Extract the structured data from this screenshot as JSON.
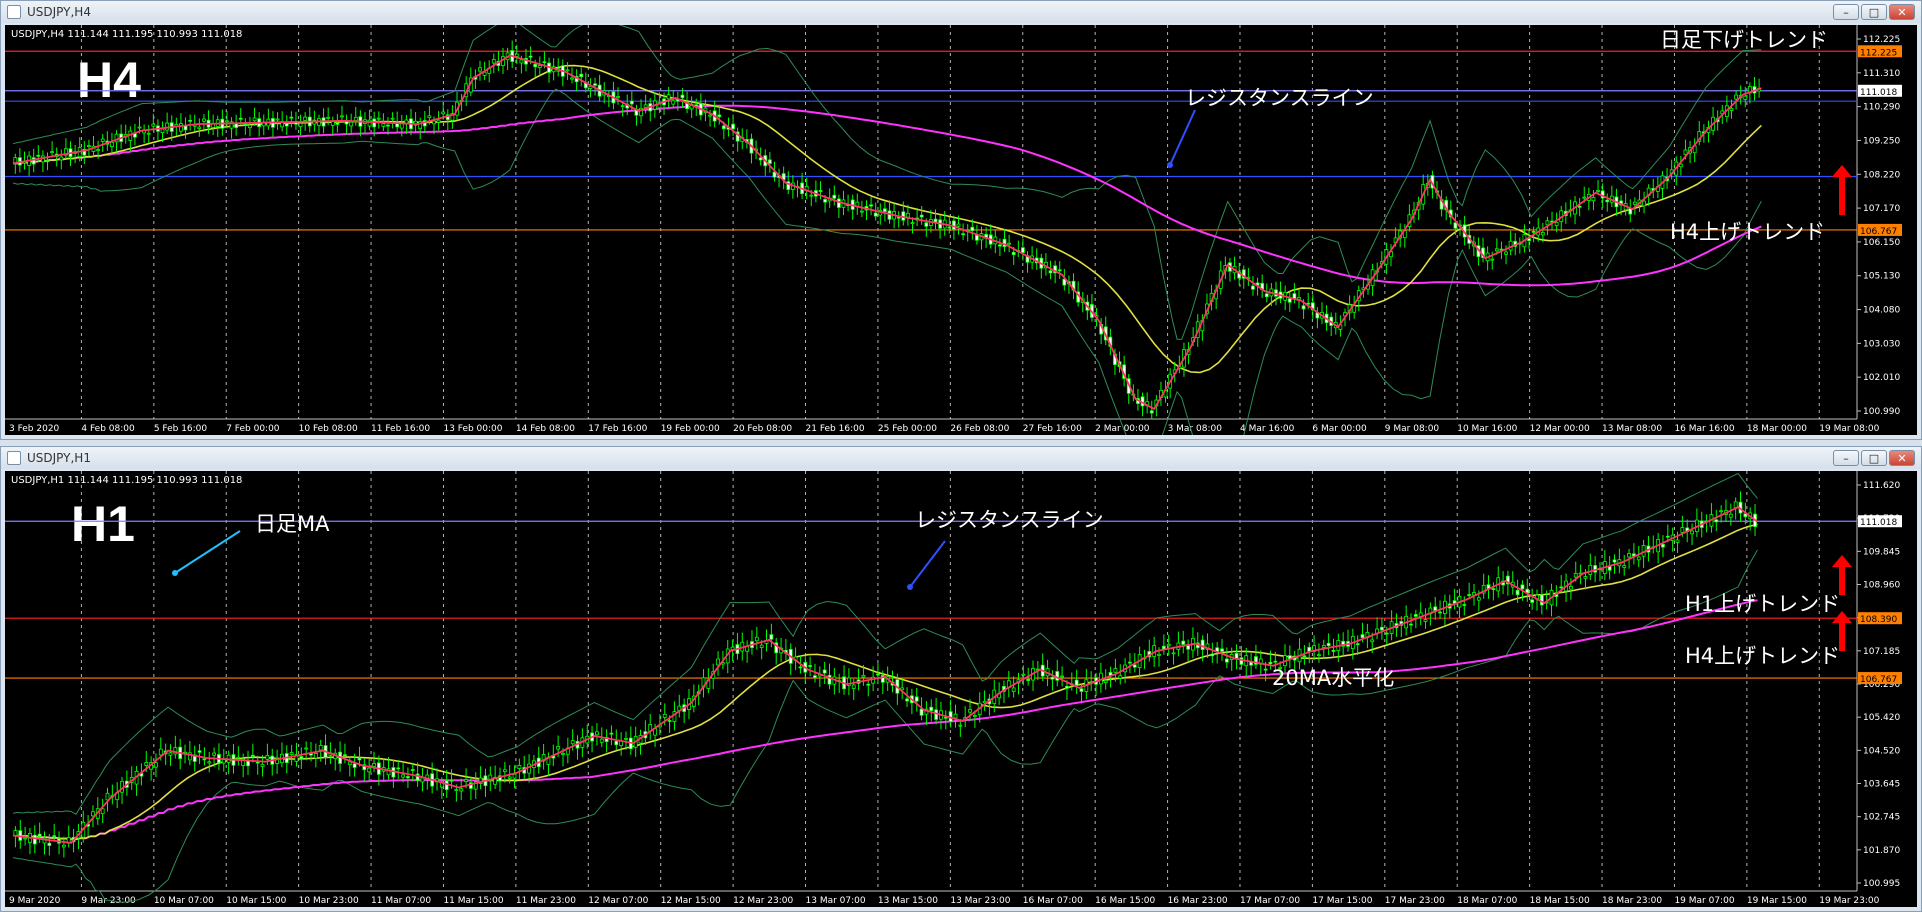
{
  "windows": [
    {
      "id": "h4",
      "title": "USDJPY,H4",
      "header": "USDJPY,H4  111.144 111.195 110.993 111.018",
      "big_label": "H4",
      "annotations": [
        {
          "text": "日足下げトレンド",
          "color": "#ffffff",
          "type": "label"
        },
        {
          "text": "レジスタンスライン",
          "color": "#ffffff",
          "type": "label"
        },
        {
          "text": "H4上げトレンド",
          "color": "#ffffff",
          "type": "label"
        }
      ],
      "price_labels": [
        {
          "value": "112.225",
          "color": "#ff8000"
        },
        {
          "value": "111.018",
          "color": "#ffffff"
        },
        {
          "value": "106.767",
          "color": "#ff8000"
        }
      ]
    },
    {
      "id": "h1",
      "title": "USDJPY,H1",
      "header": "USDJPY,H1  111.144 111.195 110.993 111.018",
      "big_label": "H1",
      "annotations": [
        {
          "text": "日足MA",
          "color": "#ffffff",
          "type": "label"
        },
        {
          "text": "レジスタンスライン",
          "color": "#ffffff",
          "type": "label"
        },
        {
          "text": "20MA水平化",
          "color": "#ffffff",
          "type": "label"
        },
        {
          "text": "H1上げトレンド",
          "color": "#ffffff",
          "type": "label"
        },
        {
          "text": "H4上げトレンド",
          "color": "#ffffff",
          "type": "label"
        }
      ],
      "price_labels": [
        {
          "value": "111.018",
          "color": "#ffffff"
        },
        {
          "value": "108.390",
          "color": "#ff8000"
        },
        {
          "value": "106.767",
          "color": "#ff8000"
        }
      ]
    }
  ],
  "chart_data": [
    {
      "type": "candlestick",
      "title": "USDJPY,H4",
      "y_ticks": [
        "112.225",
        "111.310",
        "110.290",
        "109.250",
        "108.220",
        "107.170",
        "106.150",
        "105.130",
        "104.080",
        "103.030",
        "102.010",
        "100.990"
      ],
      "ylim": [
        100.99,
        112.6
      ],
      "x_ticks": [
        "3 Feb 2020",
        "4 Feb 08:00",
        "5 Feb 16:00",
        "7 Feb 00:00",
        "10 Feb 08:00",
        "11 Feb 16:00",
        "13 Feb 00:00",
        "14 Feb 08:00",
        "17 Feb 16:00",
        "19 Feb 00:00",
        "20 Feb 08:00",
        "21 Feb 16:00",
        "25 Feb 00:00",
        "26 Feb 08:00",
        "27 Feb 16:00",
        "2 Mar 00:00",
        "3 Mar 08:00",
        "4 Mar 16:00",
        "6 Mar 00:00",
        "9 Mar 08:00",
        "10 Mar 16:00",
        "12 Mar 00:00",
        "13 Mar 08:00",
        "16 Mar 16:00",
        "18 Mar 00:00",
        "19 Mar 08:00"
      ],
      "price_path": [
        [
          0,
          108.8
        ],
        [
          4,
          109.2
        ],
        [
          7,
          109.8
        ],
        [
          10,
          110.0
        ],
        [
          18,
          110.1
        ],
        [
          22,
          110.0
        ],
        [
          24,
          110.3
        ],
        [
          25,
          111.4
        ],
        [
          27,
          112.1
        ],
        [
          30,
          111.6
        ],
        [
          32,
          111.0
        ],
        [
          34,
          110.4
        ],
        [
          36,
          110.8
        ],
        [
          38,
          110.3
        ],
        [
          40,
          109.4
        ],
        [
          42,
          108.2
        ],
        [
          45,
          107.6
        ],
        [
          48,
          107.2
        ],
        [
          51,
          106.9
        ],
        [
          54,
          106.3
        ],
        [
          57,
          105.4
        ],
        [
          59,
          104.0
        ],
        [
          61,
          101.6
        ],
        [
          62,
          101.3
        ],
        [
          64,
          103.2
        ],
        [
          66,
          105.7
        ],
        [
          68,
          104.9
        ],
        [
          70,
          104.6
        ],
        [
          72,
          103.8
        ],
        [
          74,
          105.4
        ],
        [
          76,
          107.1
        ],
        [
          77,
          108.3
        ],
        [
          78,
          107.3
        ],
        [
          80,
          105.9
        ],
        [
          82,
          106.4
        ],
        [
          84,
          107.1
        ],
        [
          86,
          107.9
        ],
        [
          88,
          107.4
        ],
        [
          90,
          108.4
        ],
        [
          92,
          109.8
        ],
        [
          94,
          110.9
        ],
        [
          95,
          111.1
        ]
      ],
      "horizontal_lines": [
        {
          "y": 112.225,
          "color": "#ff2020"
        },
        {
          "y": 111.018,
          "color": "#7f7fff"
        },
        {
          "y": 108.4,
          "color": "#3050ff"
        },
        {
          "y": 106.767,
          "color": "#ff8000"
        },
        {
          "y": 110.7,
          "color": "#3050ff"
        }
      ]
    },
    {
      "type": "candlestick",
      "title": "USDJPY,H1",
      "y_ticks": [
        "111.620",
        "110.720",
        "109.845",
        "108.960",
        "108.080",
        "107.185",
        "106.290",
        "105.420",
        "104.520",
        "103.645",
        "102.745",
        "101.870",
        "100.995"
      ],
      "ylim": [
        100.995,
        112.0
      ],
      "x_ticks": [
        "9 Mar 2020",
        "9 Mar 23:00",
        "10 Mar 07:00",
        "10 Mar 15:00",
        "10 Mar 23:00",
        "11 Mar 07:00",
        "11 Mar 15:00",
        "11 Mar 23:00",
        "12 Mar 07:00",
        "12 Mar 15:00",
        "12 Mar 23:00",
        "13 Mar 07:00",
        "13 Mar 15:00",
        "13 Mar 23:00",
        "16 Mar 07:00",
        "16 Mar 15:00",
        "16 Mar 23:00",
        "17 Mar 07:00",
        "17 Mar 15:00",
        "17 Mar 23:00",
        "18 Mar 07:00",
        "18 Mar 15:00",
        "18 Mar 23:00",
        "19 Mar 07:00",
        "19 Mar 15:00",
        "19 Mar 23:00"
      ],
      "price_path": [
        [
          0,
          102.5
        ],
        [
          3,
          102.3
        ],
        [
          5,
          103.5
        ],
        [
          8,
          104.8
        ],
        [
          10,
          104.6
        ],
        [
          13,
          104.5
        ],
        [
          16,
          104.8
        ],
        [
          18,
          104.4
        ],
        [
          21,
          104.1
        ],
        [
          23,
          103.8
        ],
        [
          26,
          104.2
        ],
        [
          28,
          104.7
        ],
        [
          30,
          105.2
        ],
        [
          32,
          105.0
        ],
        [
          35,
          106.1
        ],
        [
          37,
          107.5
        ],
        [
          39,
          107.8
        ],
        [
          41,
          107.0
        ],
        [
          43,
          106.6
        ],
        [
          45,
          106.8
        ],
        [
          47,
          105.9
        ],
        [
          49,
          105.6
        ],
        [
          51,
          106.4
        ],
        [
          53,
          107.0
        ],
        [
          55,
          106.5
        ],
        [
          57,
          106.9
        ],
        [
          59,
          107.5
        ],
        [
          61,
          107.7
        ],
        [
          63,
          107.3
        ],
        [
          65,
          107.1
        ],
        [
          67,
          107.5
        ],
        [
          69,
          107.7
        ],
        [
          71,
          108.1
        ],
        [
          73,
          108.5
        ],
        [
          75,
          108.9
        ],
        [
          77,
          109.4
        ],
        [
          79,
          108.8
        ],
        [
          81,
          109.6
        ],
        [
          83,
          109.9
        ],
        [
          85,
          110.4
        ],
        [
          87,
          110.9
        ],
        [
          89,
          111.4
        ],
        [
          90,
          111.0
        ]
      ],
      "horizontal_lines": [
        {
          "y": 111.018,
          "color": "#7f7fff"
        },
        {
          "y": 108.39,
          "color": "#ff2020"
        },
        {
          "y": 106.767,
          "color": "#ff8000"
        }
      ]
    }
  ]
}
